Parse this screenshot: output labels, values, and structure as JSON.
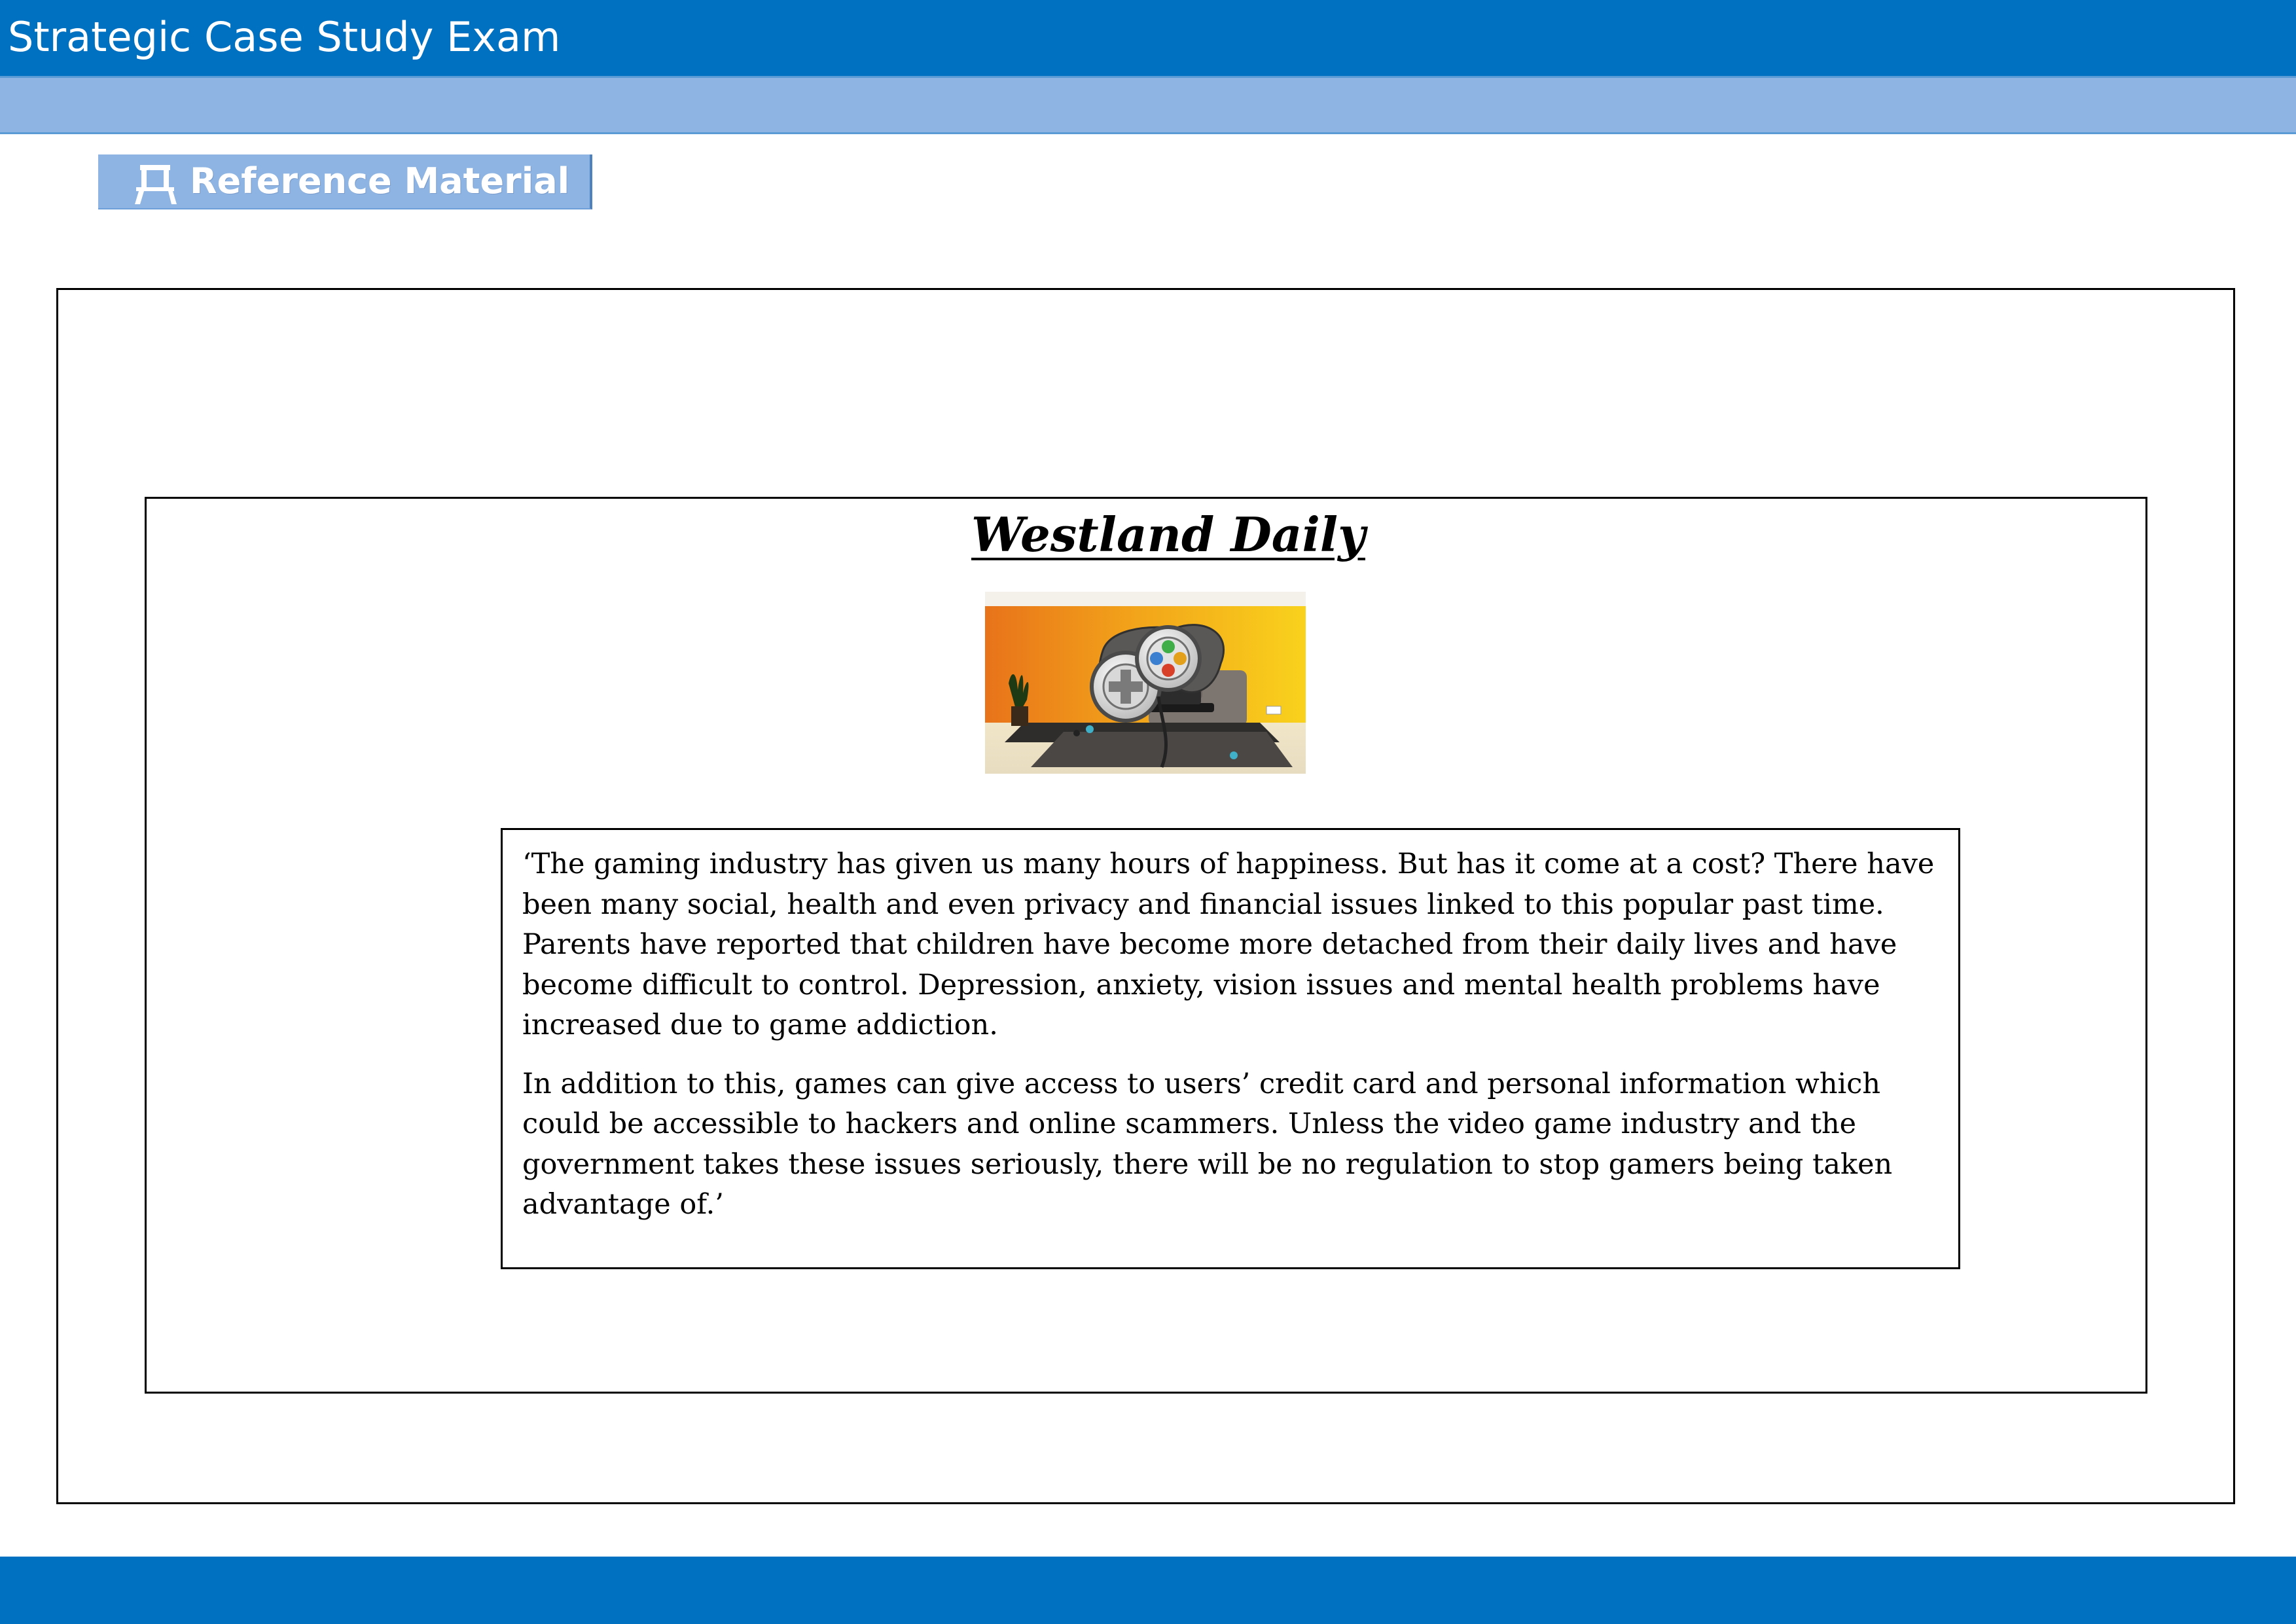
{
  "header": {
    "title": "Strategic Case Study Exam"
  },
  "toolbar": {
    "reference_button_label": "Reference Material",
    "reference_icon": "chair-icon"
  },
  "article": {
    "newspaper_name": "Westland Daily",
    "image": "game-controller-living-room-image",
    "paragraphs": [
      "‘The gaming industry has given us many hours of happiness. But has it come at a cost? There have been many social, health and even privacy and financial issues linked to this popular past time. Parents have reported that children have become more detached from their daily lives and have become difficult to control. Depression, anxiety, vision issues and mental health problems have increased due to game addiction.",
      "In addition to this, games can give access to users’ credit card and personal information which could be accessible to hackers and online scammers. Unless the video game industry and the government takes these issues seriously, there will be no regulation to stop gamers being taken advantage of.’"
    ]
  },
  "colors": {
    "header_blue": "#0070c0",
    "subbar_blue": "#8db4e2",
    "button_blue": "#8db4e2"
  }
}
